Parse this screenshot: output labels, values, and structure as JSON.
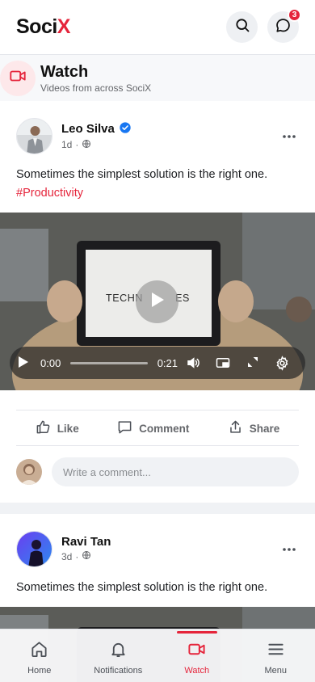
{
  "app": {
    "logo_main": "Soci",
    "logo_accent": "X",
    "messages_badge": "3",
    "accent": "#e5243b"
  },
  "watch": {
    "title": "Watch",
    "subtitle": "Videos from across SociX"
  },
  "posts": [
    {
      "author": "Leo Silva",
      "verified": true,
      "time": "1d",
      "text": "Sometimes the simplest solution is the right one.",
      "hashtag": "#Productivity",
      "video": {
        "screen_text": "TECHN",
        "screen_text_end": "ES",
        "current_time": "0:00",
        "duration": "0:21"
      },
      "actions": {
        "like": "Like",
        "comment": "Comment",
        "share": "Share"
      },
      "comment_placeholder": "Write a comment..."
    },
    {
      "author": "Ravi Tan",
      "time": "3d",
      "text": "Sometimes the simplest solution is the right one."
    }
  ],
  "nav": {
    "home": "Home",
    "notifications": "Notifications",
    "watch": "Watch",
    "menu": "Menu"
  }
}
